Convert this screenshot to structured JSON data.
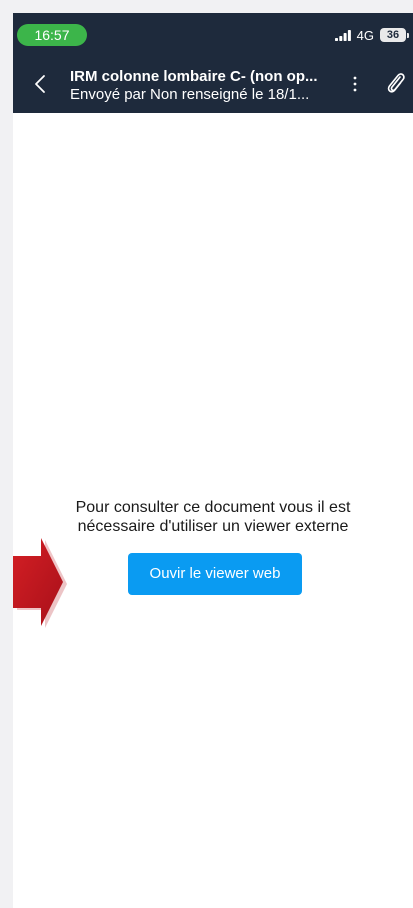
{
  "status_bar": {
    "time": "16:57",
    "network": "4G",
    "battery": "36"
  },
  "header": {
    "title": "IRM colonne lombaire C- (non op...",
    "subtitle": "Envoyé par Non renseigné le 18/1..."
  },
  "icons": {
    "back": "chevron-left-icon",
    "more": "vertical-ellipsis-icon",
    "attach": "paperclip-icon",
    "signal": "signal-bars-icon",
    "annotation": "red-arrow-icon"
  },
  "main": {
    "message_line1": "Pour consulter ce document vous il est",
    "message_line2": "nécessaire d'utiliser un viewer externe",
    "viewer_button_label": "Ouvir le viewer web"
  },
  "colors": {
    "header_bg": "#1e2a3c",
    "time_pill": "#3cb54a",
    "button": "#0a9bf2",
    "arrow": "#c4161c"
  }
}
